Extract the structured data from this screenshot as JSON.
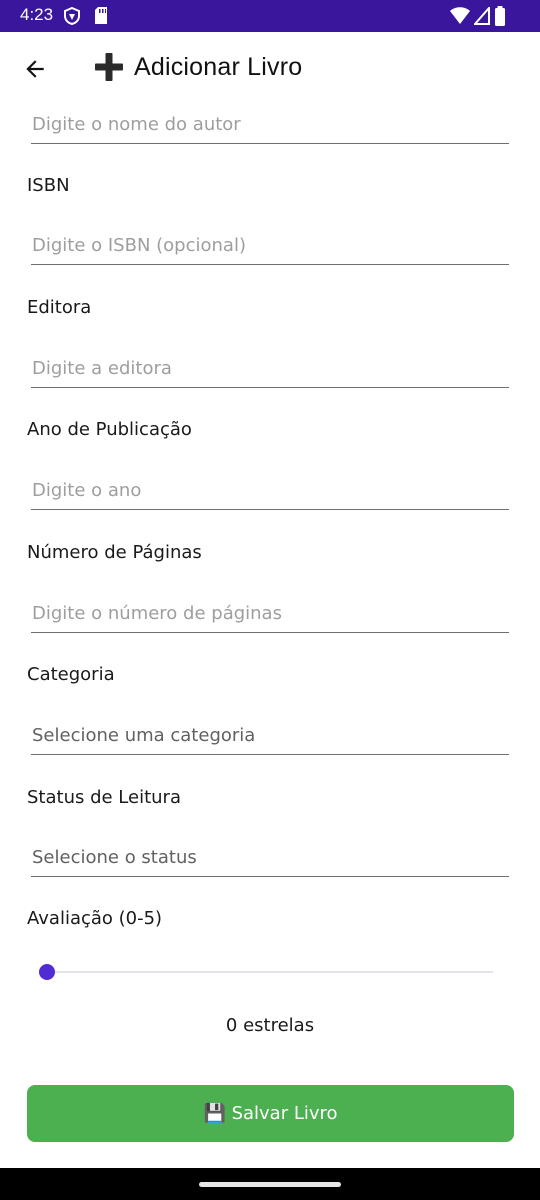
{
  "status_bar": {
    "time": "4:23",
    "icons": [
      "shield-icon",
      "sd-card-icon",
      "wifi-icon",
      "signal-icon",
      "battery-icon"
    ]
  },
  "header": {
    "title": "Adicionar Livro",
    "back_icon": "arrow-left-icon",
    "title_icon": "heavy-plus-icon"
  },
  "form": {
    "author_placeholder": "Digite o nome do autor",
    "isbn": {
      "label": "ISBN",
      "placeholder": "Digite o ISBN (opcional)"
    },
    "publisher": {
      "label": "Editora",
      "placeholder": "Digite a editora"
    },
    "year": {
      "label": "Ano de Publicação",
      "placeholder": "Digite o ano"
    },
    "pages": {
      "label": "Número de Páginas",
      "placeholder": "Digite o número de páginas"
    },
    "category": {
      "label": "Categoria",
      "value": "Selecione uma categoria"
    },
    "status": {
      "label": "Status de Leitura",
      "value": "Selecione o status"
    },
    "rating": {
      "label": "Avaliação (0-5)",
      "value": 0,
      "min": 0,
      "max": 5,
      "display": "0 estrelas"
    },
    "save_label": "💾 Salvar Livro"
  },
  "colors": {
    "status_bar": "#3a169d",
    "accent": "#512bd4",
    "save_button": "#4caf50"
  }
}
